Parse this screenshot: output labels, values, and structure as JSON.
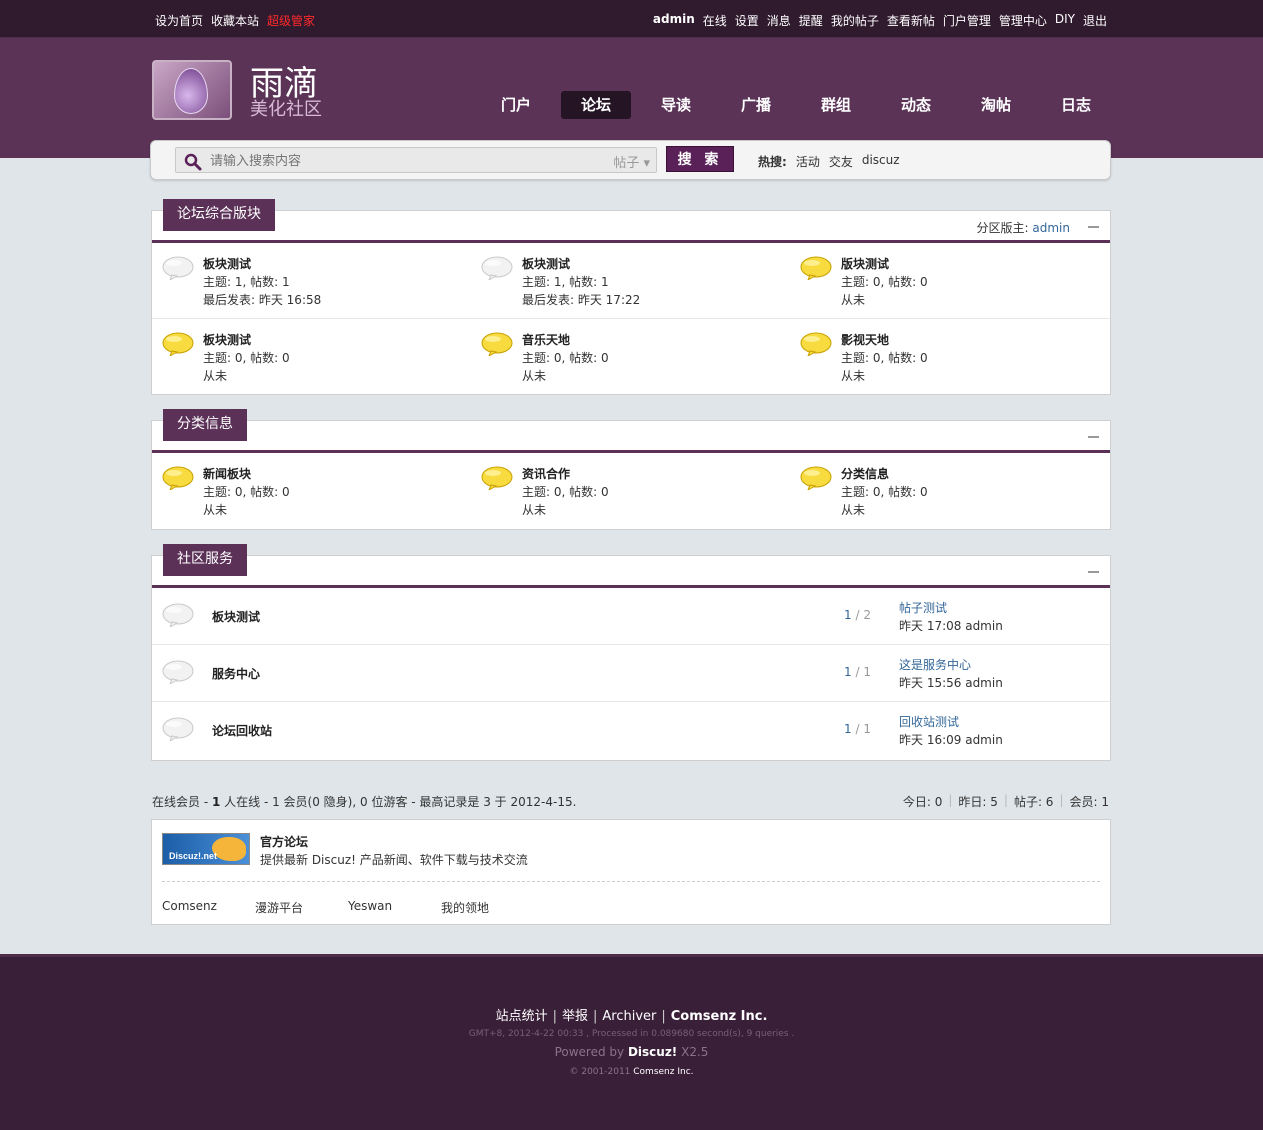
{
  "topbar": {
    "left": [
      "设为首页",
      "收藏本站",
      "超级管家"
    ],
    "user": "admin",
    "right": [
      "在线",
      "设置",
      "消息",
      "提醒",
      "我的帖子",
      "查看新帖",
      "门户管理",
      "管理中心",
      "DIY",
      "退出"
    ]
  },
  "logo": {
    "title": "雨滴",
    "subtitle": "美化社区"
  },
  "nav": [
    "门户",
    "论坛",
    "导读",
    "广播",
    "群组",
    "动态",
    "淘帖",
    "日志"
  ],
  "nav_active": "论坛",
  "search": {
    "placeholder": "请输入搜索内容",
    "type": "帖子",
    "button": "搜 索",
    "hot_label": "热搜:",
    "hot": [
      "活动",
      "交友",
      "discuz"
    ]
  },
  "group1": {
    "title": "论坛综合版块",
    "mod_label": "分区版主:",
    "mod": "admin",
    "rows": [
      [
        {
          "name": "板块测试",
          "stats": "主题: 1, 帖数: 1",
          "last": "最后发表: 昨天 16:58",
          "icon": "bubble-gray"
        },
        {
          "name": "板块测试",
          "stats": "主题: 1, 帖数: 1",
          "last": "最后发表: 昨天 17:22",
          "icon": "bubble-gray"
        },
        {
          "name": "版块测试",
          "stats": "主题: 0, 帖数: 0",
          "last": "从未",
          "icon": "bubble-yellow"
        }
      ],
      [
        {
          "name": "板块测试",
          "stats": "主题: 0, 帖数: 0",
          "last": "从未",
          "icon": "bubble-yellow"
        },
        {
          "name": "音乐天地",
          "stats": "主题: 0, 帖数: 0",
          "last": "从未",
          "icon": "bubble-yellow"
        },
        {
          "name": "影视天地",
          "stats": "主题: 0, 帖数: 0",
          "last": "从未",
          "icon": "bubble-yellow"
        }
      ]
    ]
  },
  "group2": {
    "title": "分类信息",
    "rows": [
      [
        {
          "name": "新闻板块",
          "stats": "主题: 0, 帖数: 0",
          "last": "从未",
          "icon": "bubble-yellow"
        },
        {
          "name": "资讯合作",
          "stats": "主题: 0, 帖数: 0",
          "last": "从未",
          "icon": "bubble-yellow"
        },
        {
          "name": "分类信息",
          "stats": "主题: 0, 帖数: 0",
          "last": "从未",
          "icon": "bubble-yellow"
        }
      ]
    ]
  },
  "group3": {
    "title": "社区服务",
    "rows": [
      {
        "name": "板块测试",
        "threads": "1",
        "posts": "2",
        "last_title": "帖子测试",
        "last_info": "昨天 17:08 admin"
      },
      {
        "name": "服务中心",
        "threads": "1",
        "posts": "1",
        "last_title": "这是服务中心",
        "last_info": "昨天 15:56 admin"
      },
      {
        "name": "论坛回收站",
        "threads": "1",
        "posts": "1",
        "last_title": "回收站测试",
        "last_info": "昨天 16:09 admin"
      }
    ]
  },
  "online": {
    "prefix": "在线会员 - ",
    "count": "1",
    "text": " 人在线 - 1 会员(0 隐身), 0 位游客 - 最高记录是 3 于 2012-4-15."
  },
  "stats": [
    "今日: 0",
    "昨日: 5",
    "帖子: 6",
    "会员: 1"
  ],
  "links": {
    "logo_text": "Discuz!.net",
    "official_title": "官方论坛",
    "official_desc": "提供最新 Discuz! 产品新闻、软件下载与技术交流",
    "items": [
      "Comsenz",
      "漫游平台",
      "Yeswan",
      "我的领地"
    ]
  },
  "footer": {
    "links": [
      "站点统计",
      "举报",
      "Archiver"
    ],
    "brand": "Comsenz Inc.",
    "info": "GMT+8, 2012-4-22 00:33 , Processed in 0.089680 second(s), 9 queries .",
    "powered_prefix": "Powered by ",
    "powered_name": "Discuz!",
    "powered_version": " X2.5",
    "copyright_prefix": "© 2001-2011 ",
    "copyright_company": "Comsenz Inc."
  },
  "colors": {
    "accent": "#5b3158",
    "header": "#5a3357",
    "topbar": "#2f1a2e",
    "link": "#336699"
  }
}
